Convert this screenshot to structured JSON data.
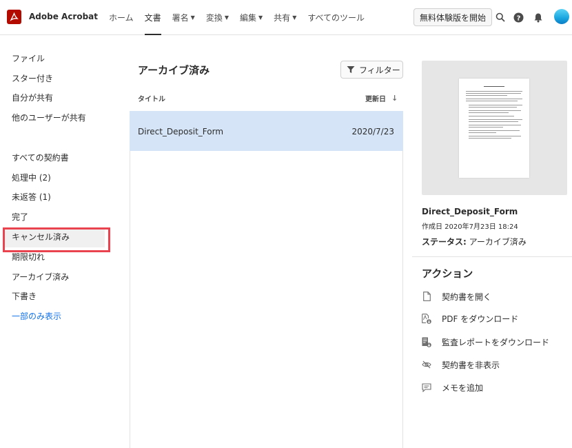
{
  "header": {
    "app_title": "Adobe Acrobat",
    "nav": [
      {
        "label": "ホーム",
        "dropdown": false,
        "active": false
      },
      {
        "label": "文書",
        "dropdown": false,
        "active": true
      },
      {
        "label": "署名",
        "dropdown": true,
        "active": false
      },
      {
        "label": "変換",
        "dropdown": true,
        "active": false
      },
      {
        "label": "編集",
        "dropdown": true,
        "active": false
      },
      {
        "label": "共有",
        "dropdown": true,
        "active": false
      },
      {
        "label": "すべてのツール",
        "dropdown": false,
        "active": false
      }
    ],
    "trial_button": "無料体験版を開始",
    "icons": [
      "search-icon",
      "help-icon",
      "bell-icon",
      "avatar"
    ]
  },
  "sidebar": {
    "group1": [
      "ファイル",
      "スター付き",
      "自分が共有",
      "他のユーザーが共有"
    ],
    "group2": [
      "すべての契約書",
      "処理中 (2)",
      "未返答 (1)",
      "完了",
      "キャンセル済み",
      "期限切れ",
      "アーカイブ済み",
      "下書き"
    ],
    "selected": "アーカイブ済み",
    "show_less_link": "一部のみ表示"
  },
  "list": {
    "title": "アーカイブ済み",
    "filter_label": "フィルター",
    "col_title": "タイトル",
    "col_date": "更新日",
    "sort_arrow": "↓",
    "rows": [
      {
        "name": "Direct_Deposit_Form",
        "date": "2020/7/23"
      }
    ]
  },
  "detail": {
    "doc_name": "Direct_Deposit_Form",
    "created": "作成日 2020年7月23日 18:24",
    "status_label": "ステータス:",
    "status_value": "アーカイブ済み",
    "actions_title": "アクション",
    "actions": [
      {
        "label": "契約書を開く",
        "icon": "document-icon"
      },
      {
        "label": "PDF をダウンロード",
        "icon": "pdf-download-icon"
      },
      {
        "label": "監査レポートをダウンロード",
        "icon": "report-download-icon"
      },
      {
        "label": "契約書を非表示",
        "icon": "hide-eye-icon"
      },
      {
        "label": "メモを追加",
        "icon": "note-icon"
      }
    ]
  },
  "colors": {
    "brand_red": "#b30b00",
    "selected_row": "#d5e5f7",
    "highlight_border": "#e8434e",
    "link_blue": "#1473e6"
  }
}
